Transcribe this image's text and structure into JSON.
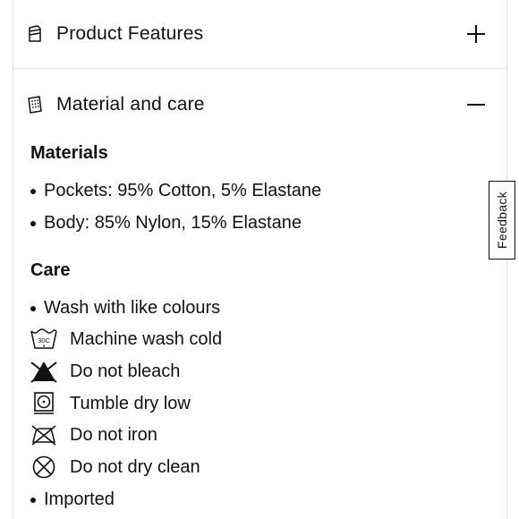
{
  "accordion": {
    "product_features": {
      "title": "Product Features",
      "icon": "shirt-tag-icon",
      "state": "collapsed"
    },
    "material_care": {
      "title": "Material and care",
      "icon": "fabric-swatch-icon",
      "state": "expanded"
    }
  },
  "materials": {
    "heading": "Materials",
    "items": [
      "Pockets: 95% Cotton, 5% Elastane",
      "Body: 85% Nylon, 15% Elastane"
    ]
  },
  "care": {
    "heading": "Care",
    "first_bullet": "Wash with like colours",
    "instructions": [
      {
        "icon": "wash-30c-icon",
        "icon_text": "30C",
        "label": "Machine wash cold"
      },
      {
        "icon": "do-not-bleach-icon",
        "label": "Do not bleach"
      },
      {
        "icon": "tumble-dry-low-icon",
        "label": "Tumble dry low"
      },
      {
        "icon": "do-not-iron-icon",
        "label": "Do not iron"
      },
      {
        "icon": "do-not-dry-clean-icon",
        "label": "Do not dry clean"
      }
    ],
    "last_bullet": "Imported"
  },
  "feedback_tab": {
    "label": "Feedback"
  }
}
